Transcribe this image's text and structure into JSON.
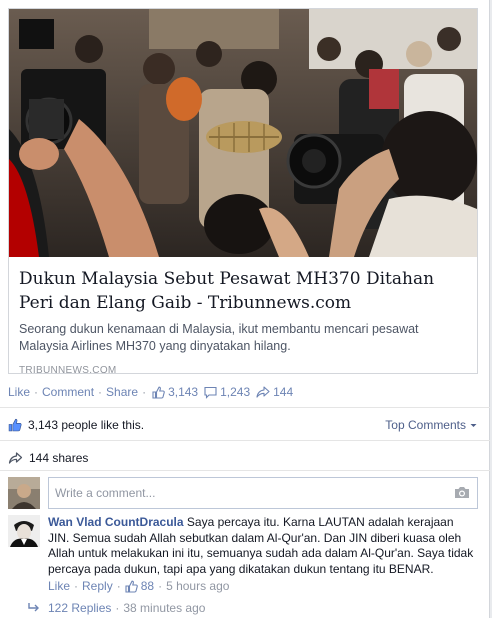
{
  "link_preview": {
    "headline": "Dukun Malaysia Sebut Pesawat MH370 Ditahan Peri dan Elang Gaib - Tribunnews.com",
    "summary": "Seorang dukun kenamaan di Malaysia, ikut membantu mencari pesawat Malaysia Airlines MH370 yang dinyatakan hilang.",
    "source": "TRIBUNNEWS.COM"
  },
  "actions": {
    "like": "Like",
    "comment": "Comment",
    "share": "Share",
    "like_count": "3,143",
    "comment_count": "1,243",
    "share_count": "144"
  },
  "likes_row": {
    "text": "3,143 people like this.",
    "top_comments": "Top Comments"
  },
  "shares_row": {
    "text": "144 shares"
  },
  "write_comment": {
    "placeholder": "Write a comment..."
  },
  "comment": {
    "author": "Wan Vlad CountDracula",
    "text": "Saya percaya itu. Karna LAUTAN adalah kerajaan JIN. Semua sudah Allah sebutkan dalam Al-Qur'an. Dan JIN diberi kuasa oleh Allah untuk melakukan ini itu, semuanya sudah ada dalam Al-Qur'an. Saya tidak percaya pada dukun, tapi apa yang dikatakan dukun tentang itu BENAR.",
    "like": "Like",
    "reply": "Reply",
    "like_count": "88",
    "time": "5 hours ago"
  },
  "replies": {
    "count": "122 Replies",
    "time": "38 minutes ago"
  },
  "colors": {
    "link": "#3b5998",
    "action": "#6d84b4",
    "muted": "#9197a3"
  }
}
